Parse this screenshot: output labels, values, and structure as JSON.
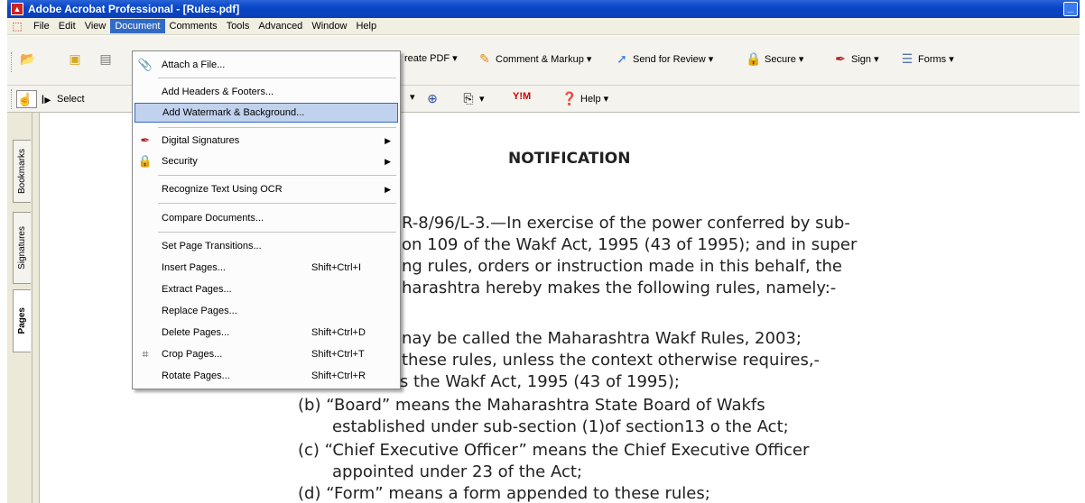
{
  "window": {
    "title": "Adobe Acrobat Professional - [Rules.pdf]",
    "minimize_glyph": "_"
  },
  "menubar": {
    "items": [
      "File",
      "Edit",
      "View",
      "Document",
      "Comments",
      "Tools",
      "Advanced",
      "Window",
      "Help"
    ],
    "active": "Document"
  },
  "toolbar1": {
    "create_pdf": "reate PDF ▾",
    "comment_markup": "Comment & Markup ▾",
    "send_review": "Send for Review ▾",
    "secure": "Secure ▾",
    "sign": "Sign ▾",
    "forms": "Forms ▾"
  },
  "toolbar2": {
    "select": "Select",
    "help": "Help ▾",
    "yahoo": "Y!M"
  },
  "navpanel": {
    "tabs": [
      "Bookmarks",
      "Signatures",
      "Pages"
    ],
    "active": "Pages"
  },
  "document_menu": {
    "items": [
      {
        "label": "Attach a File...",
        "icon": "paperclip-icon"
      },
      {
        "label": "Add Headers & Footers..."
      },
      {
        "label": "Add Watermark & Background...",
        "highlighted": true
      },
      {
        "label": "Digital Signatures",
        "icon": "pen-icon",
        "submenu": true
      },
      {
        "label": "Security",
        "icon": "lock-icon",
        "submenu": true
      },
      {
        "label": "Recognize Text Using OCR",
        "submenu": true
      },
      {
        "label": "Compare Documents..."
      },
      {
        "label": "Set Page Transitions..."
      },
      {
        "label": "Insert Pages...",
        "shortcut": "Shift+Ctrl+I"
      },
      {
        "label": "Extract Pages..."
      },
      {
        "label": "Replace Pages..."
      },
      {
        "label": "Delete Pages...",
        "shortcut": "Shift+Ctrl+D"
      },
      {
        "label": "Crop Pages...",
        "icon": "crop-icon",
        "shortcut": "Shift+Ctrl+T"
      },
      {
        "label": "Rotate Pages...",
        "shortcut": "Shift+Ctrl+R"
      }
    ]
  },
  "document": {
    "heading": "NOTIFICATION",
    "lines": [
      "R-8/96/L-3.—In exercise of the power conferred by sub-",
      "on 109 of the Wakf Act, 1995 (43 of 1995); and in super",
      "ng rules, orders or instruction made in this behalf, the",
      "harashtra hereby makes the following rules, namely:-",
      "nay be called the Maharashtra Wakf Rules, 2003;",
      "these rules, unless the context otherwise requires,-",
      "(a) “Act” means the Wakf Act, 1995 (43 of 1995);",
      "(b) “Board”  means  the  Maharashtra  State  Board  of  Wakfs",
      "established under sub-section (1)of section13 o the Act;",
      "(c) “Chief Executive Officer” means the Chief Executive Officer",
      "appointed under 23 of the Act;",
      "(d) “Form” means a form appended to these rules;"
    ]
  },
  "colors": {
    "titlebar": "#0a46c8",
    "menu_highlight": "#316ac5",
    "item_highlight": "#c1d2ee"
  }
}
